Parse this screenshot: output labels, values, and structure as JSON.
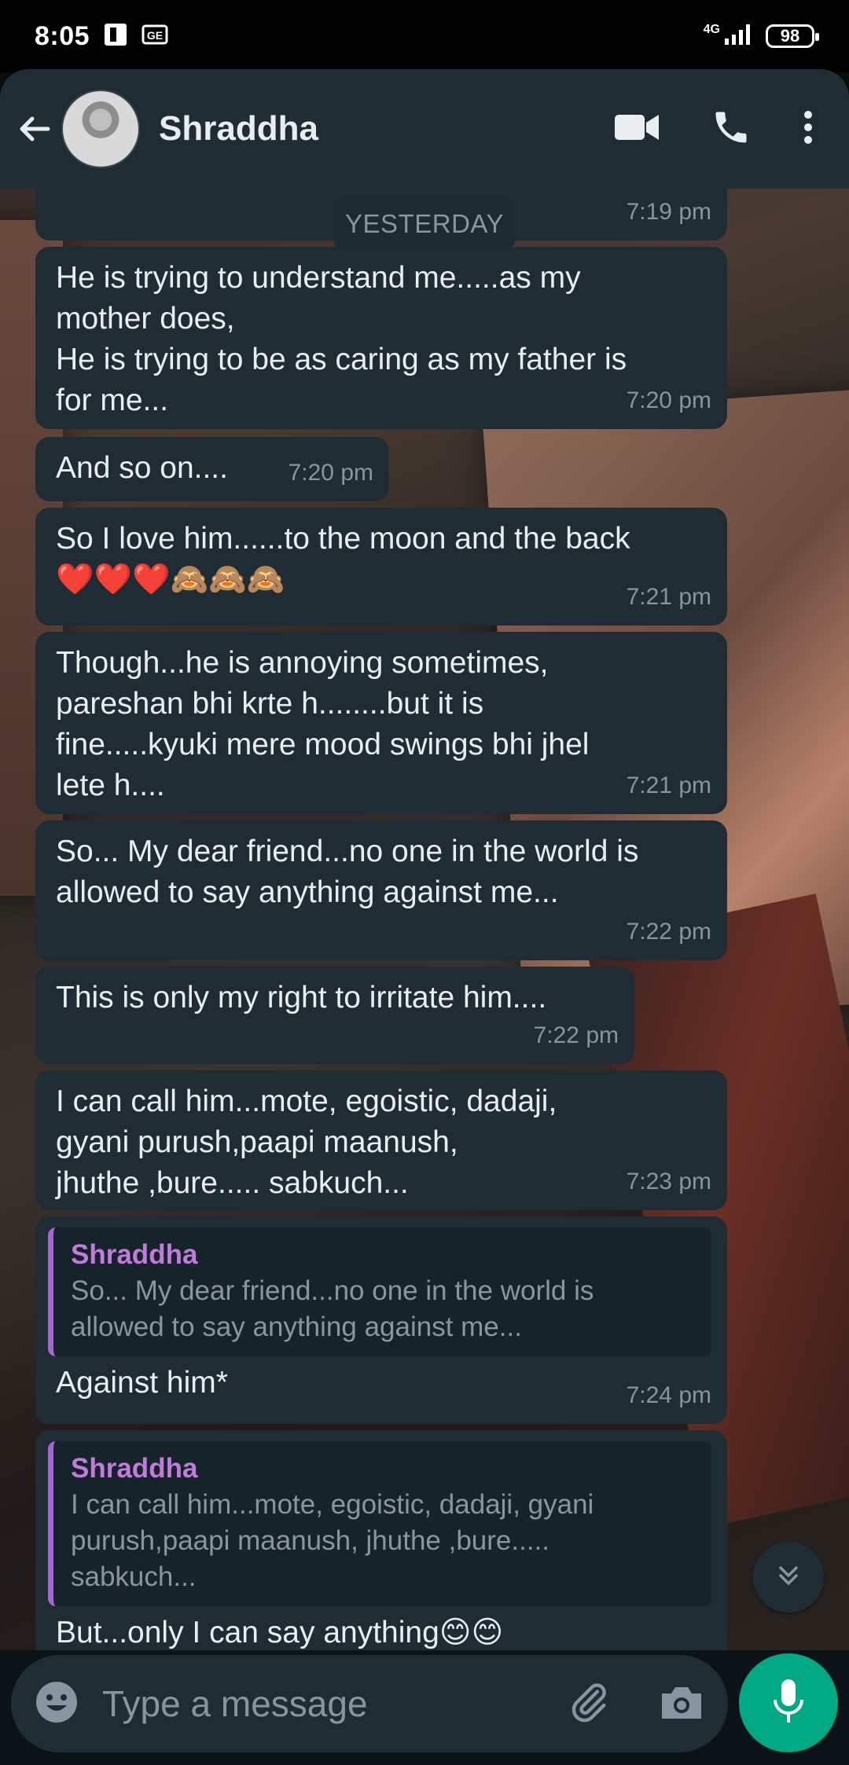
{
  "status_bar": {
    "time": "8:05",
    "network": "4G",
    "battery": "98"
  },
  "header": {
    "contact_name": "Shraddha"
  },
  "day_separator": "YESTERDAY",
  "messages": [
    {
      "text": "",
      "time": "7:19 pm"
    },
    {
      "text": "He is trying to understand me.....as my\nmother does,\nHe is trying to be as caring as my father is\nfor me...",
      "time": "7:20 pm"
    },
    {
      "text": "And so on....",
      "time": "7:20 pm"
    },
    {
      "text": "So I love him......to the moon and the back\n❤️❤️❤️🙈🙈🙈",
      "time": "7:21 pm"
    },
    {
      "text": "Though...he is annoying sometimes,\npareshan bhi krte h........but it is\nfine.....kyuki mere mood swings bhi jhel\nlete h....",
      "time": "7:21 pm"
    },
    {
      "text": "So... My dear friend...no one in the world is\nallowed to say anything against me...",
      "time": "7:22 pm"
    },
    {
      "text": "This is only my right to irritate him....",
      "time": "7:22 pm"
    },
    {
      "text": "I can call him...mote, egoistic, dadaji,\ngyani purush,paapi maanush,\njhuthe ,bure..... sabkuch...",
      "time": "7:23 pm"
    },
    {
      "quote_name": "Shraddha",
      "quote_text": "So... My dear friend...no one in the world is\nallowed to say anything against me...",
      "text": "Against him*",
      "time": "7:24 pm"
    },
    {
      "quote_name": "Shraddha",
      "quote_text": "I can call him...mote, egoistic, dadaji, gyani\npurush,paapi maanush, jhuthe ,bure.....\nsabkuch...",
      "text": "But...only I can say anything😊😊",
      "time": ""
    }
  ],
  "input": {
    "placeholder": "Type a message"
  },
  "colors": {
    "header_bg": "#1f2c34",
    "bubble_bg": "#1f2c34",
    "accent_green": "#00a884",
    "quote_bar": "#a666d1"
  },
  "icons": [
    "back-arrow-icon",
    "video-call-icon",
    "voice-call-icon",
    "more-options-icon",
    "emoji-icon",
    "attach-icon",
    "camera-icon",
    "mic-icon",
    "scroll-down-icon"
  ]
}
